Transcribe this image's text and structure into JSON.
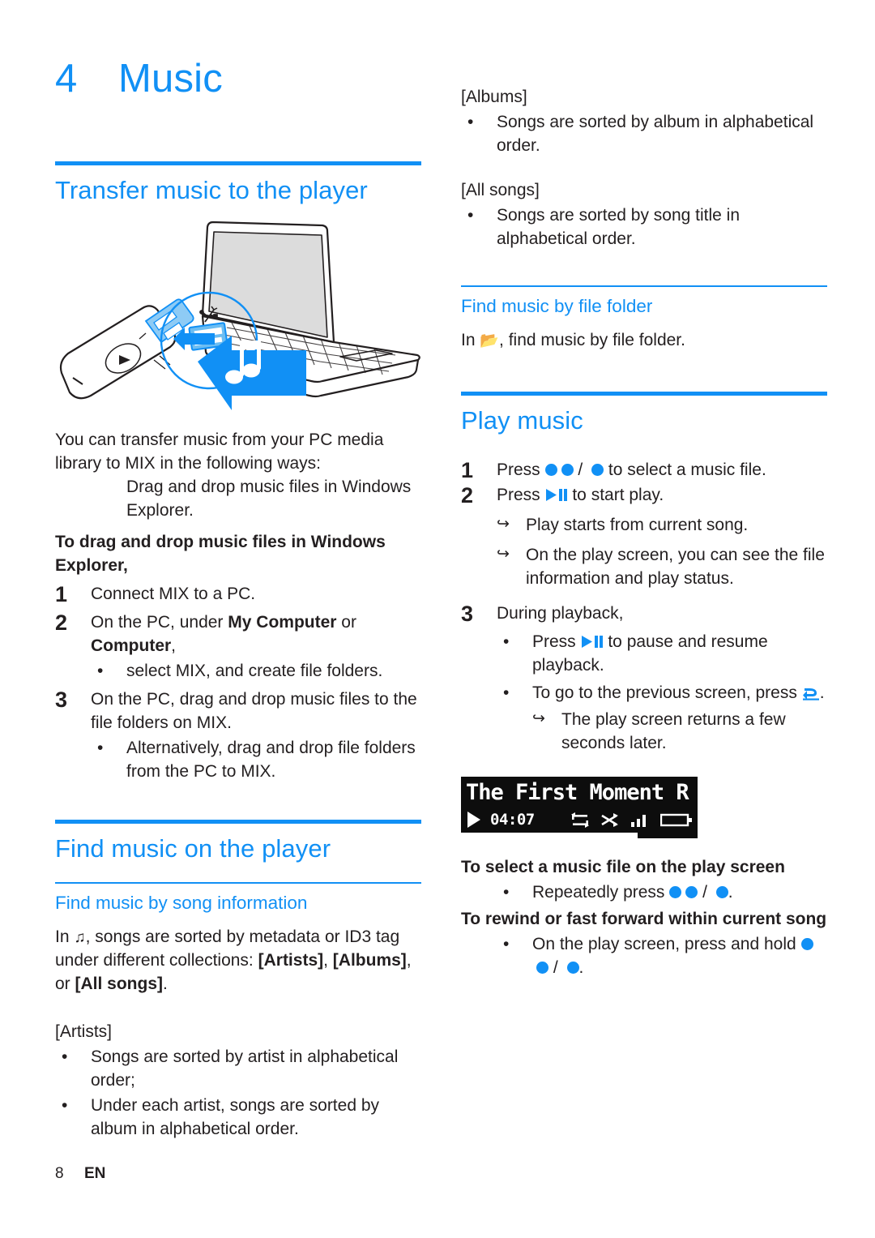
{
  "colors": {
    "accent_blue": "#1190f5",
    "body_text": "#231f20",
    "lcd_background": "#0d0d0d",
    "lcd_foreground": "#ffffff"
  },
  "chapter": {
    "number": "4",
    "title": "Music"
  },
  "left_column": {
    "section_transfer": {
      "heading": "Transfer music to the player",
      "illustration_name": "usb-player-to-laptop-music-transfer",
      "intro": "You can transfer music from your PC media library to MIX in the following ways:",
      "intro_bullet": "Drag and drop music files in Windows Explorer.",
      "procedure_heading": "To drag and drop music files in Windows Explorer,",
      "steps": [
        {
          "number": "1",
          "text_parts": [
            {
              "text": "Connect MIX to a PC.",
              "bold": false
            }
          ]
        },
        {
          "number": "2",
          "text_parts": [
            {
              "text": "On the PC, under ",
              "bold": false
            },
            {
              "text": "My Computer",
              "bold": true
            },
            {
              "text": " or ",
              "bold": false
            },
            {
              "text": "Computer",
              "bold": true
            },
            {
              "text": ",",
              "bold": false
            }
          ],
          "bullets": [
            "select MIX, and create file folders."
          ]
        },
        {
          "number": "3",
          "text_parts": [
            {
              "text": "On the PC, drag and drop music files to the file folders on MIX.",
              "bold": false
            }
          ],
          "bullets": [
            "Alternatively, drag and drop file folders from the PC to MIX."
          ]
        }
      ]
    },
    "section_find": {
      "heading": "Find music on the player",
      "subheading": "Find music by song information",
      "intro_prefix": "In ",
      "intro_icon": "music-note-icon",
      "intro_suffix_parts": [
        {
          "text": ", songs are sorted by metadata or ID3 tag under different collections: ",
          "bold": false
        },
        {
          "text": "[Artists]",
          "bold": true
        },
        {
          "text": ", ",
          "bold": false
        },
        {
          "text": "[Albums]",
          "bold": true
        },
        {
          "text": ", or ",
          "bold": false
        },
        {
          "text": "[All songs]",
          "bold": true
        },
        {
          "text": ".",
          "bold": false
        }
      ],
      "artists_label": "[Artists]",
      "artists_bullets": [
        "Songs are sorted by artist in alphabetical order;",
        "Under each artist, songs are sorted by album in alphabetical order."
      ]
    }
  },
  "right_column": {
    "albums_label": "[Albums]",
    "albums_bullets": [
      "Songs are sorted by album in alphabetical order."
    ],
    "all_songs_label": "[All songs]",
    "all_songs_bullets": [
      "Songs are sorted by song title in alphabetical order."
    ],
    "section_file_folder": {
      "subheading": "Find music by file folder",
      "text_prefix": "In ",
      "text_icon": "folder-icon",
      "text_suffix": ", find music by file folder."
    },
    "section_play": {
      "heading": "Play music",
      "steps": [
        {
          "number": "1",
          "prefix": "Press ",
          "icons": "nav-dots",
          "suffix": " to select a music file."
        },
        {
          "number": "2",
          "prefix": "Press ",
          "icons": "play-pause-icon",
          "suffix": " to start play.",
          "results": [
            "Play starts from current song.",
            "On the play screen, you can see the file information and play status."
          ]
        },
        {
          "number": "3",
          "prefix": "During playback,",
          "bullets": [
            {
              "prefix": "Press ",
              "icons": "play-pause-icon",
              "suffix": " to pause and resume playback."
            },
            {
              "prefix": "To go to the previous screen, press ",
              "icons": "back-arrow-icon",
              "suffix": ".",
              "results": [
                "The play screen returns a few seconds later."
              ]
            }
          ]
        }
      ],
      "lcd": {
        "title": "The First Moment R",
        "play_icon": "play-icon",
        "time": "04:07",
        "status_icons": [
          "repeat-icon",
          "shuffle-icon",
          "signal-bars-icon",
          "battery-icon"
        ]
      },
      "select_heading": "To select a music file on the play screen",
      "select_bullet": {
        "prefix": "Repeatedly press ",
        "icons": "nav-dots",
        "suffix": "."
      },
      "rewind_heading": "To rewind or fast forward within current song",
      "rewind_bullet": {
        "prefix": "On the play screen, press and hold ",
        "icons": "nav-dots",
        "suffix": "."
      }
    }
  },
  "footer": {
    "page_number": "8",
    "language": "EN"
  }
}
